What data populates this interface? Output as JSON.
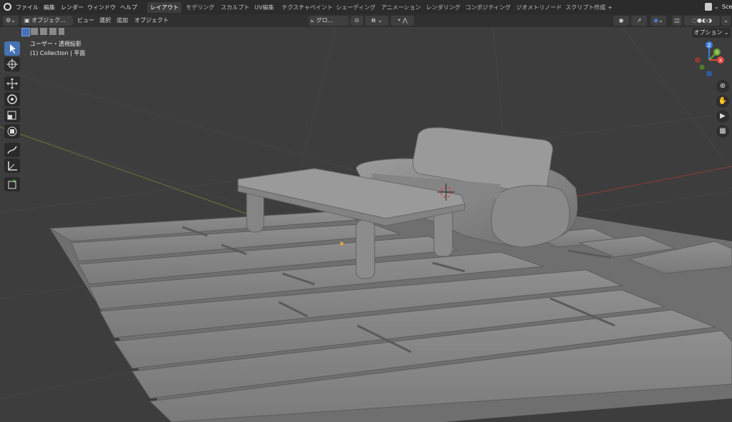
{
  "menubar": {
    "items": [
      "ファイル",
      "編集",
      "レンダー",
      "ウィンドウ",
      "ヘルプ"
    ],
    "tabs": [
      "レイアウト",
      "モデリング",
      "スカルプト",
      "UV編集",
      "テクスチャペイント",
      "シェーディング",
      "アニメーション",
      "レンダリング",
      "コンポジティング",
      "ジオメトリノード",
      "スクリプト作成"
    ],
    "add_tab": "+",
    "scene_label": "Scer"
  },
  "header": {
    "mode": "オブジェク...",
    "menu": [
      "ビュー",
      "選択",
      "追加",
      "オブジェクト"
    ],
    "orientation": "グロ...",
    "options": "オプション"
  },
  "viewport": {
    "view_name": "ユーザー・透視投影",
    "collection": "(1) Collection | 平面"
  },
  "gizmo": {
    "x": "X",
    "y": "Y",
    "z": "Z"
  },
  "colors": {
    "accent": "#4772b3",
    "x_axis": "#e2473f",
    "y_axis": "#6fa534",
    "z_axis": "#3d7fe0"
  }
}
